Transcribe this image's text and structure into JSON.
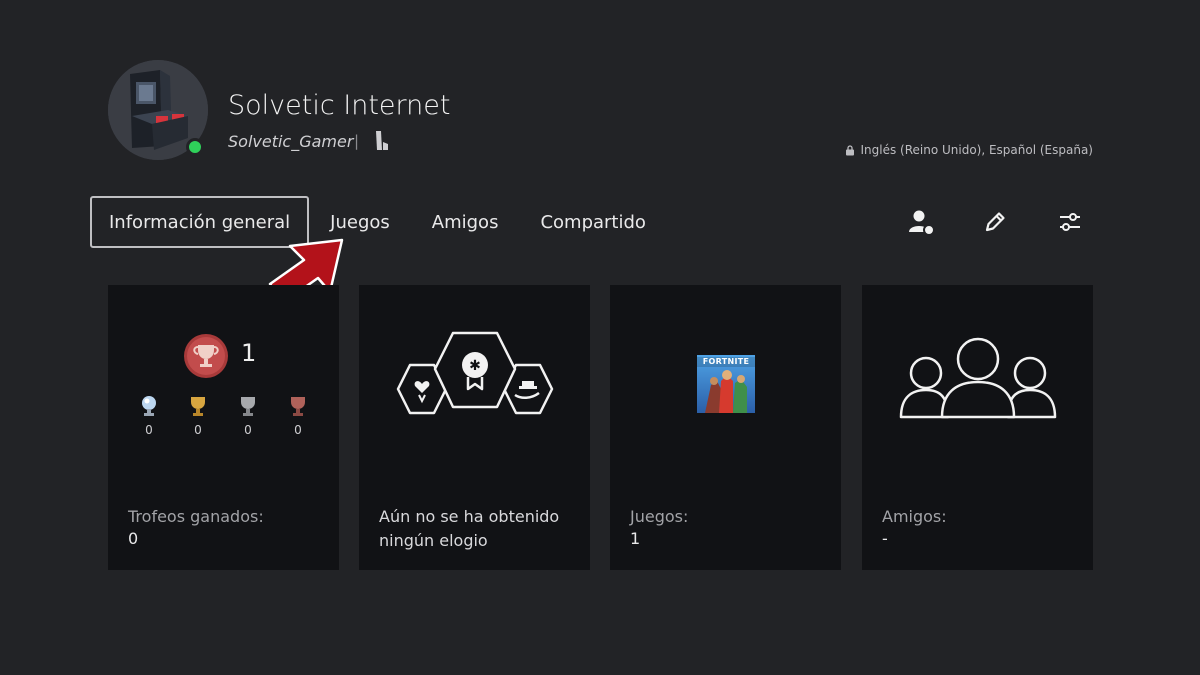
{
  "profile": {
    "display_name": "Solvetic Internet",
    "online_id": "Solvetic_Gamer",
    "separator": "|",
    "languages": "Inglés (Reino Unido), Español (España)",
    "status_color": "#2fd05a"
  },
  "tabs": [
    {
      "label": "Información general",
      "selected": true
    },
    {
      "label": "Juegos",
      "selected": false
    },
    {
      "label": "Amigos",
      "selected": false
    },
    {
      "label": "Compartido",
      "selected": false
    }
  ],
  "toolbar": {
    "icons": [
      "add-friend-icon",
      "edit-pencil-icon",
      "settings-sliders-icon"
    ]
  },
  "cards": {
    "trophies": {
      "level": "1",
      "tiers": [
        {
          "icon": "platinum-trophy-icon",
          "count": "0"
        },
        {
          "icon": "gold-trophy-icon",
          "count": "0"
        },
        {
          "icon": "silver-trophy-icon",
          "count": "0"
        },
        {
          "icon": "bronze-trophy-icon",
          "count": "0"
        }
      ],
      "label": "Trofeos ganados:",
      "value": "0"
    },
    "commendations": {
      "text": "Aún no se ha obtenido ningún elogio"
    },
    "games": {
      "thumbnail_text": "FORTNITE",
      "label": "Juegos:",
      "value": "1"
    },
    "friends": {
      "label": "Amigos:",
      "value": "-"
    }
  },
  "colors": {
    "background": "#222326",
    "card": "#111215",
    "arrow": "#b3121a"
  }
}
